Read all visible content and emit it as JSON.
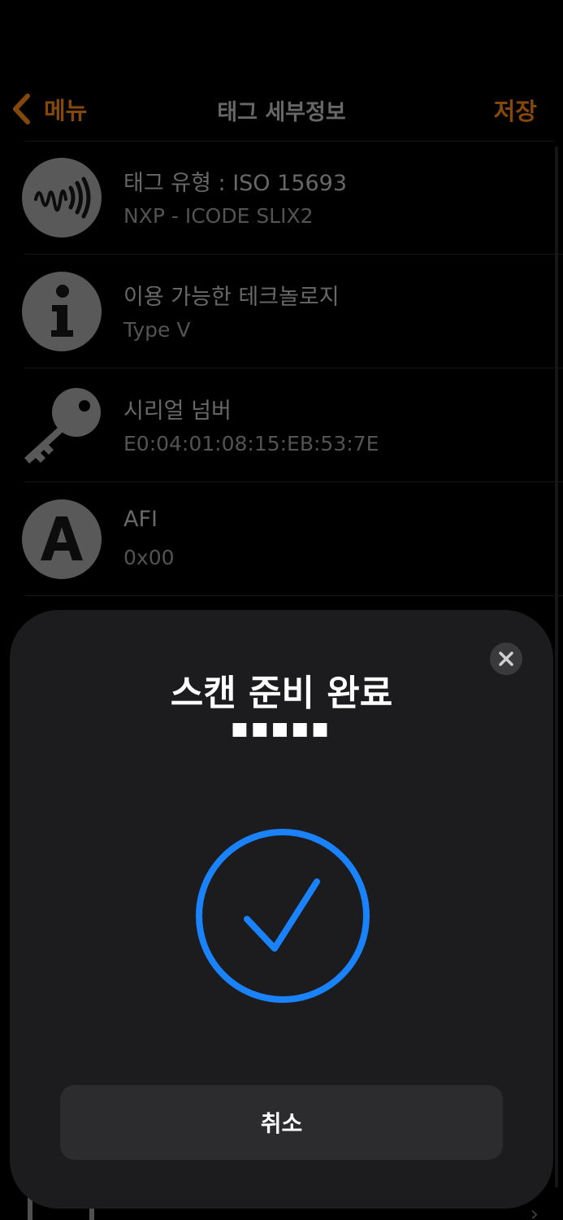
{
  "nav": {
    "back_label": "메뉴",
    "title": "태그 세부정보",
    "save_label": "저장"
  },
  "rows": [
    {
      "icon": "nfc-waves-icon",
      "title": "태그 유형 : ISO 15693",
      "subtitle": "NXP - ICODE SLIX2"
    },
    {
      "icon": "info-icon",
      "title": "이용 가능한 테크놀로지",
      "subtitle": "Type V"
    },
    {
      "icon": "key-icon",
      "title": "시리얼 넘버",
      "subtitle": "E0:04:01:08:15:EB:53:7E"
    },
    {
      "icon": "letter-a-icon",
      "title": "AFI",
      "subtitle": "0x00"
    }
  ],
  "sheet": {
    "title": "스캔 준비 완료",
    "message": "■■■■■",
    "cancel_label": "취소"
  },
  "colors": {
    "accent": "#b2600f",
    "check_blue": "#1a82fb",
    "sheet_bg": "#1c1c1e"
  }
}
